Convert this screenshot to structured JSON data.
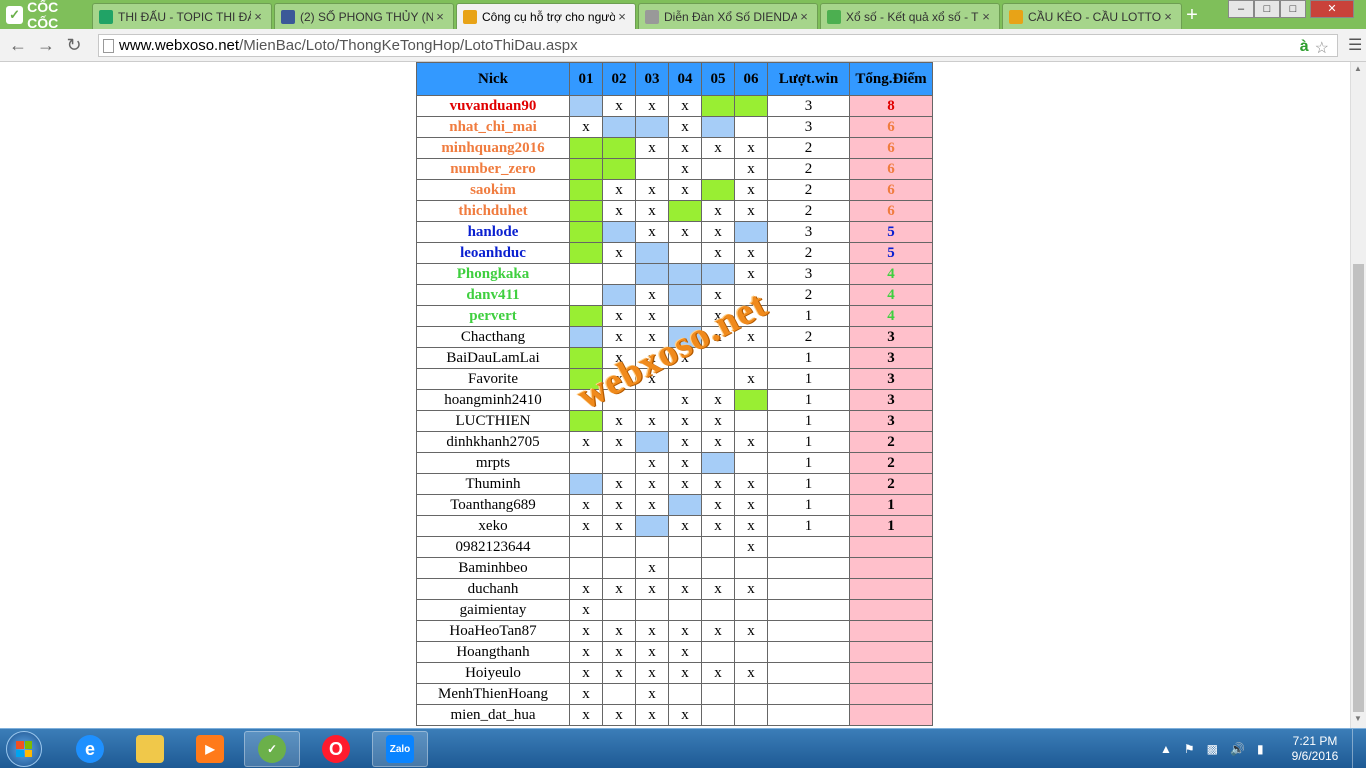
{
  "browser": {
    "brand": "CỐC CỐC",
    "tabs": [
      {
        "title": "THI ĐẤU - TOPIC THI ĐẤ",
        "icon_color": "#21a366",
        "icon": "sheet-icon"
      },
      {
        "title": "(2) SỐ PHONG THỦY (Nc",
        "icon_color": "#3b5998",
        "icon": "facebook-icon"
      },
      {
        "title": "Công cụ hỗ trợ cho ngườ",
        "icon_color": "#e8a317",
        "icon": "xs-icon",
        "active": true
      },
      {
        "title": "Diễn Đàn Xổ Số DIENDA",
        "icon_color": "#999999",
        "icon": "page-icon"
      },
      {
        "title": "Xổ số - Kết quả xổ số - T",
        "icon_color": "#4caf50",
        "icon": "xoso-icon"
      },
      {
        "title": "CẦU KÈO - CẦU LOTTO -",
        "icon_color": "#e8a317",
        "icon": "xs-icon"
      }
    ],
    "url_host": "www.webxoso.net",
    "url_path": "/MienBac/Loto/ThongKeTongHop/LotoThiDau.aspx"
  },
  "table": {
    "headers": [
      "Nick",
      "01",
      "02",
      "03",
      "04",
      "05",
      "06",
      "Lượt.win",
      "Tổng.Điểm"
    ],
    "rows": [
      {
        "nick": "vuvanduan90",
        "color": "red",
        "cells": [
          [
            "b",
            ""
          ],
          [
            "",
            "x"
          ],
          [
            "",
            "x"
          ],
          [
            "",
            "x"
          ],
          [
            "g",
            ""
          ],
          [
            "g",
            ""
          ]
        ],
        "win": "3",
        "total": "8"
      },
      {
        "nick": "nhat_chi_mai",
        "color": "orange",
        "cells": [
          [
            "",
            "x"
          ],
          [
            "b",
            ""
          ],
          [
            "b",
            ""
          ],
          [
            "",
            "x"
          ],
          [
            "b",
            ""
          ],
          [
            "",
            ""
          ]
        ],
        "win": "3",
        "total": "6"
      },
      {
        "nick": "minhquang2016",
        "color": "orange",
        "cells": [
          [
            "g",
            ""
          ],
          [
            "g",
            ""
          ],
          [
            "",
            "x"
          ],
          [
            "",
            "x"
          ],
          [
            "",
            "x"
          ],
          [
            "",
            "x"
          ]
        ],
        "win": "2",
        "total": "6"
      },
      {
        "nick": "number_zero",
        "color": "orange",
        "cells": [
          [
            "g",
            ""
          ],
          [
            "g",
            ""
          ],
          [
            "",
            ""
          ],
          [
            "",
            "x"
          ],
          [
            "",
            ""
          ],
          [
            "",
            "x"
          ]
        ],
        "win": "2",
        "total": "6"
      },
      {
        "nick": "saokim",
        "color": "orange",
        "cells": [
          [
            "g",
            ""
          ],
          [
            "",
            "x"
          ],
          [
            "",
            "x"
          ],
          [
            "",
            "x"
          ],
          [
            "g",
            ""
          ],
          [
            "",
            "x"
          ]
        ],
        "win": "2",
        "total": "6"
      },
      {
        "nick": "thichduhet",
        "color": "orange",
        "cells": [
          [
            "g",
            ""
          ],
          [
            "",
            "x"
          ],
          [
            "",
            "x"
          ],
          [
            "g",
            ""
          ],
          [
            "",
            "x"
          ],
          [
            "",
            "x"
          ]
        ],
        "win": "2",
        "total": "6"
      },
      {
        "nick": "hanlode",
        "color": "blue",
        "cells": [
          [
            "g",
            ""
          ],
          [
            "b",
            ""
          ],
          [
            "",
            "x"
          ],
          [
            "",
            "x"
          ],
          [
            "",
            "x"
          ],
          [
            "b",
            ""
          ]
        ],
        "win": "3",
        "total": "5"
      },
      {
        "nick": "leoanhduc",
        "color": "blue",
        "cells": [
          [
            "g",
            ""
          ],
          [
            "",
            "x"
          ],
          [
            "b",
            ""
          ],
          [
            "",
            ""
          ],
          [
            "",
            "x"
          ],
          [
            "",
            "x"
          ]
        ],
        "win": "2",
        "total": "5"
      },
      {
        "nick": "Phongkaka",
        "color": "green",
        "cells": [
          [
            "",
            ""
          ],
          [
            "",
            ""
          ],
          [
            "b",
            ""
          ],
          [
            "b",
            ""
          ],
          [
            "b",
            ""
          ],
          [
            "",
            "x"
          ]
        ],
        "win": "3",
        "total": "4"
      },
      {
        "nick": "danv411",
        "color": "green",
        "cells": [
          [
            "",
            ""
          ],
          [
            "b",
            ""
          ],
          [
            "",
            "x"
          ],
          [
            "b",
            ""
          ],
          [
            "",
            "x"
          ],
          [
            "",
            ""
          ]
        ],
        "win": "2",
        "total": "4"
      },
      {
        "nick": "pervert",
        "color": "green",
        "cells": [
          [
            "g",
            ""
          ],
          [
            "",
            "x"
          ],
          [
            "",
            "x"
          ],
          [
            "",
            ""
          ],
          [
            "",
            "x"
          ],
          [
            "",
            ""
          ]
        ],
        "win": "1",
        "total": "4"
      },
      {
        "nick": "Chacthang",
        "color": "",
        "cells": [
          [
            "b",
            ""
          ],
          [
            "",
            "x"
          ],
          [
            "",
            "x"
          ],
          [
            "b",
            ""
          ],
          [
            "",
            "x"
          ],
          [
            "",
            "x"
          ]
        ],
        "win": "2",
        "total": "3"
      },
      {
        "nick": "BaiDauLamLai",
        "color": "",
        "cells": [
          [
            "g",
            ""
          ],
          [
            "",
            "x"
          ],
          [
            "",
            "x"
          ],
          [
            "",
            "x"
          ],
          [
            "",
            ""
          ],
          [
            "",
            ""
          ]
        ],
        "win": "1",
        "total": "3"
      },
      {
        "nick": "Favorite",
        "color": "",
        "cells": [
          [
            "g",
            ""
          ],
          [
            "",
            "x"
          ],
          [
            "",
            "x"
          ],
          [
            "",
            ""
          ],
          [
            "",
            ""
          ],
          [
            "",
            "x"
          ]
        ],
        "win": "1",
        "total": "3"
      },
      {
        "nick": "hoangminh2410",
        "color": "",
        "cells": [
          [
            "",
            ""
          ],
          [
            "",
            ""
          ],
          [
            "",
            ""
          ],
          [
            "",
            "x"
          ],
          [
            "",
            "x"
          ],
          [
            "g",
            ""
          ]
        ],
        "win": "1",
        "total": "3"
      },
      {
        "nick": "LUCTHIEN",
        "color": "",
        "cells": [
          [
            "g",
            ""
          ],
          [
            "",
            "x"
          ],
          [
            "",
            "x"
          ],
          [
            "",
            "x"
          ],
          [
            "",
            "x"
          ],
          [
            "",
            ""
          ]
        ],
        "win": "1",
        "total": "3"
      },
      {
        "nick": "dinhkhanh2705",
        "color": "",
        "cells": [
          [
            "",
            "x"
          ],
          [
            "",
            "x"
          ],
          [
            "b",
            ""
          ],
          [
            "",
            "x"
          ],
          [
            "",
            "x"
          ],
          [
            "",
            "x"
          ]
        ],
        "win": "1",
        "total": "2"
      },
      {
        "nick": "mrpts",
        "color": "",
        "cells": [
          [
            "",
            ""
          ],
          [
            "",
            ""
          ],
          [
            "",
            "x"
          ],
          [
            "",
            "x"
          ],
          [
            "b",
            ""
          ],
          [
            "",
            ""
          ]
        ],
        "win": "1",
        "total": "2"
      },
      {
        "nick": "Thuminh",
        "color": "",
        "cells": [
          [
            "b",
            ""
          ],
          [
            "",
            "x"
          ],
          [
            "",
            "x"
          ],
          [
            "",
            "x"
          ],
          [
            "",
            "x"
          ],
          [
            "",
            "x"
          ]
        ],
        "win": "1",
        "total": "2"
      },
      {
        "nick": "Toanthang689",
        "color": "",
        "cells": [
          [
            "",
            "x"
          ],
          [
            "",
            "x"
          ],
          [
            "",
            "x"
          ],
          [
            "b",
            ""
          ],
          [
            "",
            "x"
          ],
          [
            "",
            "x"
          ]
        ],
        "win": "1",
        "total": "1"
      },
      {
        "nick": "xeko",
        "color": "",
        "cells": [
          [
            "",
            "x"
          ],
          [
            "",
            "x"
          ],
          [
            "b",
            ""
          ],
          [
            "",
            "x"
          ],
          [
            "",
            "x"
          ],
          [
            "",
            "x"
          ]
        ],
        "win": "1",
        "total": "1"
      },
      {
        "nick": "0982123644",
        "color": "",
        "cells": [
          [
            "",
            ""
          ],
          [
            "",
            ""
          ],
          [
            "",
            ""
          ],
          [
            "",
            ""
          ],
          [
            "",
            ""
          ],
          [
            "",
            "x"
          ]
        ],
        "win": "",
        "total": ""
      },
      {
        "nick": "Baminhbeo",
        "color": "",
        "cells": [
          [
            "",
            ""
          ],
          [
            "",
            ""
          ],
          [
            "",
            "x"
          ],
          [
            "",
            ""
          ],
          [
            "",
            ""
          ],
          [
            "",
            ""
          ]
        ],
        "win": "",
        "total": ""
      },
      {
        "nick": "duchanh",
        "color": "",
        "cells": [
          [
            "",
            "x"
          ],
          [
            "",
            "x"
          ],
          [
            "",
            "x"
          ],
          [
            "",
            "x"
          ],
          [
            "",
            "x"
          ],
          [
            "",
            "x"
          ]
        ],
        "win": "",
        "total": ""
      },
      {
        "nick": "gaimientay",
        "color": "",
        "cells": [
          [
            "",
            "x"
          ],
          [
            "",
            ""
          ],
          [
            "",
            ""
          ],
          [
            "",
            ""
          ],
          [
            "",
            ""
          ],
          [
            "",
            ""
          ]
        ],
        "win": "",
        "total": ""
      },
      {
        "nick": "HoaHeoTan87",
        "color": "",
        "cells": [
          [
            "",
            "x"
          ],
          [
            "",
            "x"
          ],
          [
            "",
            "x"
          ],
          [
            "",
            "x"
          ],
          [
            "",
            "x"
          ],
          [
            "",
            "x"
          ]
        ],
        "win": "",
        "total": ""
      },
      {
        "nick": "Hoangthanh",
        "color": "",
        "cells": [
          [
            "",
            "x"
          ],
          [
            "",
            "x"
          ],
          [
            "",
            "x"
          ],
          [
            "",
            "x"
          ],
          [
            "",
            ""
          ],
          [
            "",
            ""
          ]
        ],
        "win": "",
        "total": ""
      },
      {
        "nick": "Hoiyeulo",
        "color": "",
        "cells": [
          [
            "",
            "x"
          ],
          [
            "",
            "x"
          ],
          [
            "",
            "x"
          ],
          [
            "",
            "x"
          ],
          [
            "",
            "x"
          ],
          [
            "",
            "x"
          ]
        ],
        "win": "",
        "total": ""
      },
      {
        "nick": "MenhThienHoang",
        "color": "",
        "cells": [
          [
            "",
            "x"
          ],
          [
            "",
            ""
          ],
          [
            "",
            "x"
          ],
          [
            "",
            ""
          ],
          [
            "",
            ""
          ],
          [
            "",
            ""
          ]
        ],
        "win": "",
        "total": ""
      },
      {
        "nick": "mien_dat_hua",
        "color": "",
        "cells": [
          [
            "",
            "x"
          ],
          [
            "",
            "x"
          ],
          [
            "",
            "x"
          ],
          [
            "",
            "x"
          ],
          [
            "",
            ""
          ],
          [
            "",
            ""
          ]
        ],
        "win": "",
        "total": ""
      }
    ]
  },
  "watermark": "webxoso.net",
  "taskbar": {
    "apps": [
      "internet-explorer",
      "file-explorer",
      "media-player",
      "coccoc-browser",
      "opera-browser",
      "zalo"
    ],
    "zalo_label": "Zalo",
    "time": "7:21 PM",
    "date": "9/6/2016"
  }
}
